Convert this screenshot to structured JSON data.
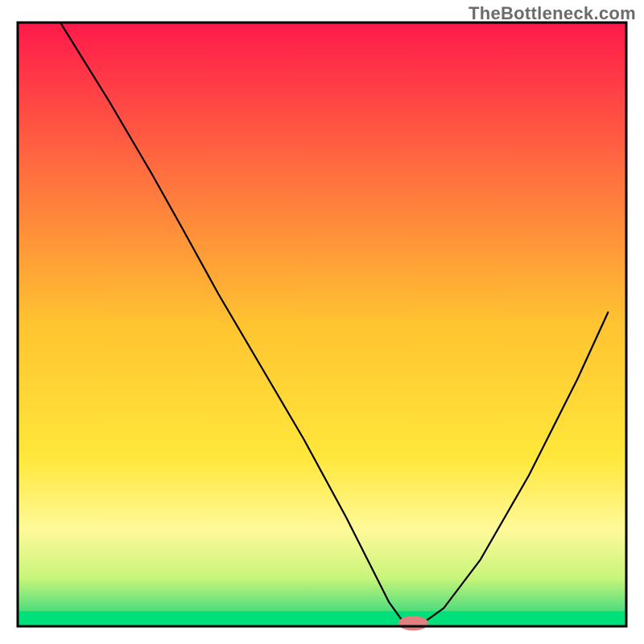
{
  "watermark": "TheBottleneck.com",
  "chart_data": {
    "type": "line",
    "title": "",
    "xlabel": "",
    "ylabel": "",
    "xlim": [
      0,
      100
    ],
    "ylim": [
      0,
      100
    ],
    "grid": false,
    "legend": false,
    "background_gradient": {
      "stops": [
        {
          "offset": 0.0,
          "color": "#ff1a4b"
        },
        {
          "offset": 0.25,
          "color": "#ff6f3f"
        },
        {
          "offset": 0.5,
          "color": "#ffc431"
        },
        {
          "offset": 0.72,
          "color": "#ffe73a"
        },
        {
          "offset": 0.84,
          "color": "#fff99a"
        },
        {
          "offset": 0.92,
          "color": "#c8f57a"
        },
        {
          "offset": 0.97,
          "color": "#5adf7d"
        },
        {
          "offset": 1.0,
          "color": "#00e07a"
        }
      ]
    },
    "bottom_band": {
      "y_from": 97.5,
      "y_to": 100,
      "color": "#00e07a"
    },
    "series": [
      {
        "name": "bottleneck-curve",
        "color": "#000000",
        "width": 2.2,
        "points": [
          {
            "x": 7.0,
            "y": 100.0
          },
          {
            "x": 15.0,
            "y": 87.0
          },
          {
            "x": 22.0,
            "y": 75.0
          },
          {
            "x": 27.0,
            "y": 66.0
          },
          {
            "x": 33.0,
            "y": 55.0
          },
          {
            "x": 40.0,
            "y": 43.0
          },
          {
            "x": 47.0,
            "y": 31.0
          },
          {
            "x": 54.0,
            "y": 18.0
          },
          {
            "x": 58.0,
            "y": 10.0
          },
          {
            "x": 61.0,
            "y": 4.0
          },
          {
            "x": 63.5,
            "y": 0.5
          },
          {
            "x": 66.5,
            "y": 0.5
          },
          {
            "x": 70.0,
            "y": 3.0
          },
          {
            "x": 76.0,
            "y": 11.0
          },
          {
            "x": 84.0,
            "y": 25.0
          },
          {
            "x": 92.0,
            "y": 41.0
          },
          {
            "x": 97.0,
            "y": 52.0
          }
        ]
      }
    ],
    "marker": {
      "x": 65.0,
      "y": 0.5,
      "rx": 2.5,
      "ry": 1.2,
      "color": "#e08080"
    },
    "frame": {
      "color": "#000000",
      "width": 3
    }
  }
}
